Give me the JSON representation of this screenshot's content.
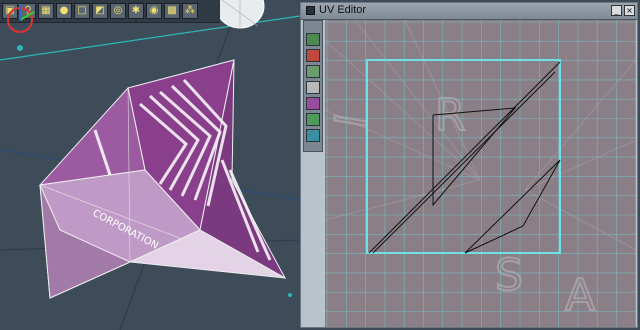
{
  "toolbar": {
    "buttons": [
      {
        "icon": "camera-icon",
        "glyph": "▣"
      },
      {
        "icon": "bulb-icon",
        "glyph": "♀"
      },
      {
        "icon": "grid-icon",
        "glyph": "▦"
      },
      {
        "icon": "sphere-icon",
        "glyph": "●"
      },
      {
        "icon": "box-icon",
        "glyph": "□"
      },
      {
        "icon": "texture-icon",
        "glyph": "◩"
      },
      {
        "icon": "lasso-icon",
        "glyph": "◎"
      },
      {
        "icon": "particles-icon",
        "glyph": "✱"
      },
      {
        "icon": "material-icon",
        "glyph": "◉"
      },
      {
        "icon": "cubes-icon",
        "glyph": "▩"
      },
      {
        "icon": "node-icon",
        "glyph": "⁂"
      }
    ]
  },
  "uv_editor": {
    "title": "UV Editor",
    "minimize_glyph": "_",
    "close_glyph": "×",
    "texture_letters": [
      "S",
      "A",
      "R",
      "I"
    ]
  },
  "model_texture": {
    "word": "CORPORATION"
  },
  "colors": {
    "viewport_bg": "#3e4c5a",
    "mesh_purple": "#8a3f8c",
    "mesh_light": "#d9c3dc",
    "uv_bounds": "#6fe0e6",
    "uv_grid": "#72c7cf",
    "uv_bg": "#8a7f86"
  }
}
